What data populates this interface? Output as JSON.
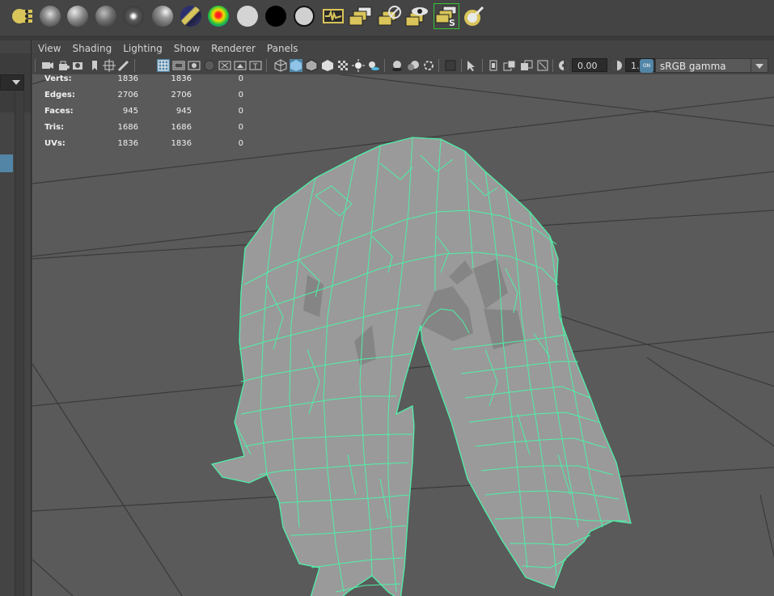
{
  "shelf": {
    "icons": [
      "move-tool-icon",
      "soft-sphere-icon",
      "sphere-1-icon",
      "sphere-2-icon",
      "sphere-3-icon",
      "sphere-4-icon",
      "striped-sphere-icon",
      "rainbow-sphere-icon",
      "white-sphere-icon",
      "black-sphere-icon",
      "white-sphere-2-icon",
      "graph-editor-icon",
      "layer-1-icon",
      "layer-2-icon",
      "layer-eye-icon",
      "selected-layer-icon",
      "renderer-icon"
    ]
  },
  "menu": {
    "items": [
      "View",
      "Shading",
      "Lighting",
      "Show",
      "Renderer",
      "Panels"
    ]
  },
  "toolbar": {
    "exposure_value": "0.00",
    "gamma_value": "1.00",
    "colorspace": "sRGB gamma",
    "on_label": "ON"
  },
  "hud": {
    "rows": [
      {
        "label": "Verts:",
        "v1": "1836",
        "v2": "1836",
        "v3": "0"
      },
      {
        "label": "Edges:",
        "v1": "2706",
        "v2": "2706",
        "v3": "0"
      },
      {
        "label": "Faces:",
        "v1": "945",
        "v2": "945",
        "v3": "0"
      },
      {
        "label": "Tris:",
        "v1": "1686",
        "v2": "1686",
        "v3": "0"
      },
      {
        "label": "UVs:",
        "v1": "1836",
        "v2": "1836",
        "v3": "0"
      }
    ]
  },
  "colors": {
    "wire": "#4ef0a8",
    "mesh_fill": "#9a9a9a",
    "viewport_bg": "#5a5a5a",
    "selection_accent": "#5285a6"
  }
}
